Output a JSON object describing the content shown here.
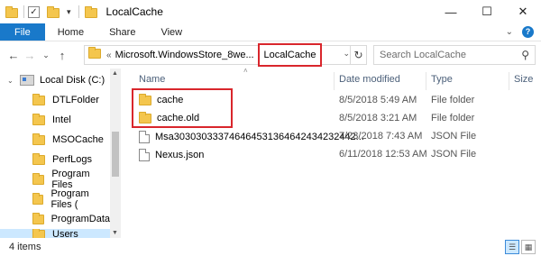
{
  "window": {
    "title": "LocalCache",
    "controls": {
      "minimize": "—",
      "maximize": "☐",
      "close": "✕"
    }
  },
  "quick_access": {
    "dropdown": "▾"
  },
  "ribbon": {
    "tabs": [
      "File",
      "Home",
      "Share",
      "View"
    ],
    "collapse": "⌄",
    "help": "?"
  },
  "address": {
    "back": "←",
    "forward": "→",
    "recent": "⌄",
    "up": "↑",
    "overflow": "«",
    "crumbs": [
      "Microsoft.WindowsStore_8we..."
    ],
    "current": "LocalCache",
    "refresh": "↻",
    "dropdown": "⌄"
  },
  "search": {
    "placeholder": "Search LocalCache",
    "icon": "search-icon"
  },
  "nav_pane": {
    "root": {
      "label": "Local Disk (C:)",
      "icon": "drive-icon"
    },
    "items": [
      {
        "label": "DTLFolder"
      },
      {
        "label": "Intel"
      },
      {
        "label": "MSOCache"
      },
      {
        "label": "PerfLogs"
      },
      {
        "label": "Program Files"
      },
      {
        "label": "Program Files ("
      },
      {
        "label": "ProgramData"
      },
      {
        "label": "Users",
        "selected": true
      }
    ]
  },
  "columns": {
    "name": "Name",
    "date": "Date modified",
    "type": "Type",
    "size": "Size"
  },
  "files": [
    {
      "name": "cache",
      "date": "8/5/2018 5:49 AM",
      "type": "File folder",
      "icon": "folder-icon"
    },
    {
      "name": "cache.old",
      "date": "8/5/2018 3:21 AM",
      "type": "File folder",
      "icon": "folder-icon"
    },
    {
      "name": "Msa303030333746464531364642434232442...",
      "date": "7/23/2018 7:43 AM",
      "type": "JSON File",
      "icon": "file-icon"
    },
    {
      "name": "Nexus.json",
      "date": "6/11/2018 12:53 AM",
      "type": "JSON File",
      "icon": "file-icon"
    }
  ],
  "status": {
    "item_count": "4 items"
  },
  "accent": {
    "file_tab": "#1979ca",
    "highlight": "#d9262c",
    "selected": "#cce8ff"
  }
}
